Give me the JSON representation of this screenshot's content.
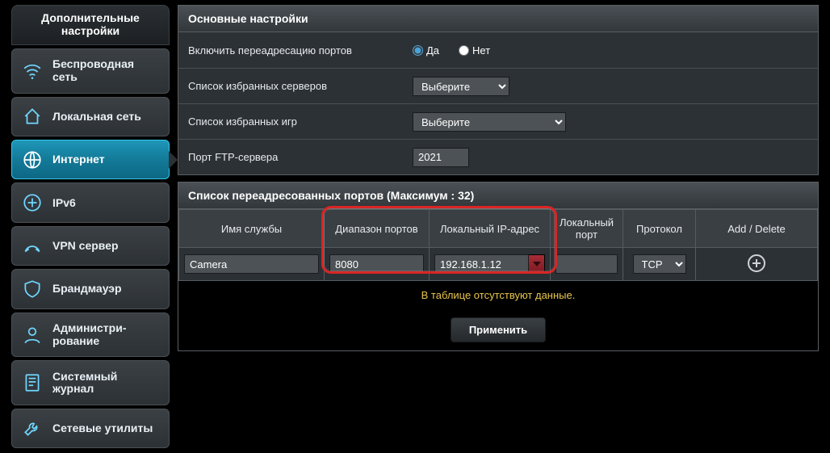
{
  "sidebar": {
    "title": "Дополнительные настройки",
    "items": [
      {
        "label": "Беспроводная сеть"
      },
      {
        "label": "Локальная сеть"
      },
      {
        "label": "Интернет"
      },
      {
        "label": "IPv6"
      },
      {
        "label": "VPN сервер"
      },
      {
        "label": "Брандмауэр"
      },
      {
        "label": "Админист­ри-\nрование"
      },
      {
        "label": "Системный журнал"
      },
      {
        "label": "Сетевые утилиты"
      }
    ]
  },
  "basic": {
    "heading": "Основные настройки",
    "rows": {
      "enable": {
        "label": "Включить переадресацию портов",
        "yes": "Да",
        "no": "Нет"
      },
      "servers": {
        "label": "Список избранных серверов",
        "select": "Выберите"
      },
      "games": {
        "label": "Список избранных игр",
        "select": "Выберите"
      },
      "ftp": {
        "label": "Порт FTP-сервера",
        "value": "2021"
      }
    }
  },
  "forward": {
    "heading": "Список переадресованных портов (Максимум : 32)",
    "headers": {
      "service": "Имя службы",
      "range": "Диапазон портов",
      "ip": "Локальный IP-адрес",
      "localport": "Локальный порт",
      "proto": "Протокол",
      "actions": "Add / Delete"
    },
    "row": {
      "service": "Camera",
      "range": "8080",
      "ip": "192.168.1.12",
      "localport": "",
      "proto": "TCP"
    },
    "nodata": "В таблице отсутствуют данные.",
    "apply": "Применить"
  }
}
